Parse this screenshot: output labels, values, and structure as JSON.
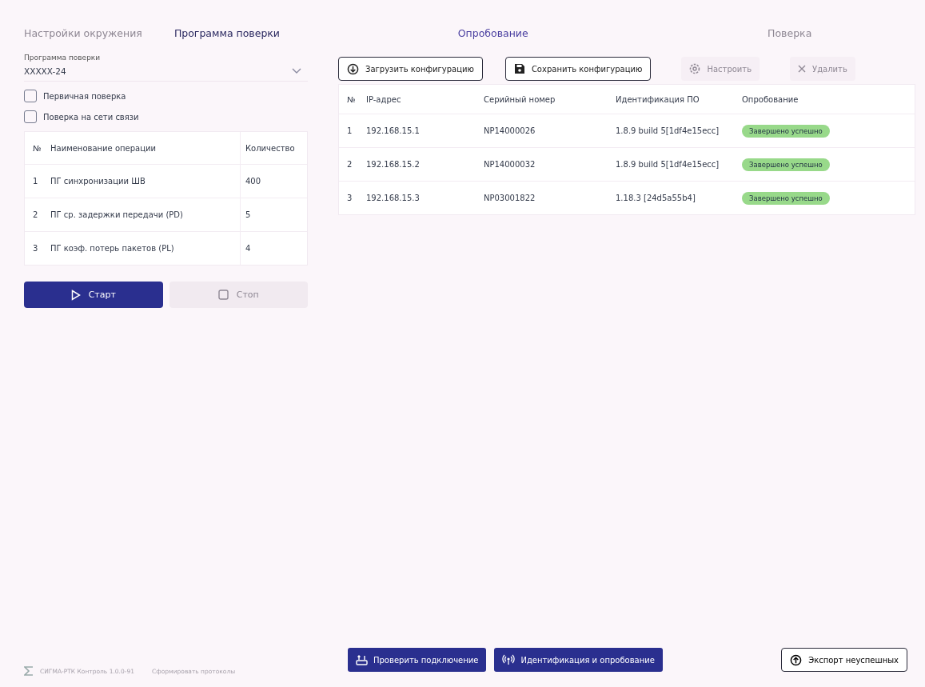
{
  "left_tabs": [
    {
      "label": "Настройки окружения",
      "disabled": true
    },
    {
      "label": "Программа поверки",
      "disabled": false
    }
  ],
  "right_tabs": [
    {
      "label": "Опробование",
      "disabled": false
    },
    {
      "label": "Поверка",
      "disabled": true
    }
  ],
  "program": {
    "label": "Программа поверки",
    "value": "XXXXX-24"
  },
  "checkboxes": [
    {
      "label": "Первичная поверка",
      "checked": false
    },
    {
      "label": "Поверка на сети связи",
      "checked": false
    }
  ],
  "operations": {
    "columns": [
      "№",
      "Наименование операции",
      "Количество"
    ],
    "rows": [
      [
        "1",
        "ПГ синхронизации ШВ",
        "400"
      ],
      [
        "2",
        "ПГ ср. задержки передачи (PD)",
        "5"
      ],
      [
        "3",
        "ПГ коэф. потерь пакетов (PL)",
        "4"
      ]
    ]
  },
  "run_buttons": [
    {
      "kind": "start",
      "label": "Старт",
      "disabled": false
    },
    {
      "kind": "stop",
      "label": "Стоп",
      "disabled": true
    }
  ],
  "toolbar": [
    {
      "kind": "load",
      "label": "Загрузить конфигурацию",
      "disabled": false
    },
    {
      "kind": "save",
      "label": "Сохранить конфигурацию",
      "disabled": false
    },
    {
      "kind": "configure",
      "label": "Настроить",
      "disabled": true
    },
    {
      "kind": "delete",
      "label": "Удалить",
      "disabled": true
    }
  ],
  "devices": {
    "columns": [
      "№",
      "IP-адрес",
      "Серийный номер",
      "Идентификация ПО",
      "Опробование"
    ],
    "rows": [
      {
        "cells": [
          "1",
          "192.168.15.1",
          "NP14000026",
          "1.8.9 build 5[1df4e15ecc]"
        ],
        "status": "Завершено успешно",
        "kind": "success"
      },
      {
        "cells": [
          "2",
          "192.168.15.2",
          "NP14000032",
          "1.8.9 build 5[1df4e15ecc]"
        ],
        "status": "Завершено успешно",
        "kind": "success"
      },
      {
        "cells": [
          "3",
          "192.168.15.3",
          "NP03001822",
          "1.18.3 [24d5a55b4]"
        ],
        "status": "Завершено успешно",
        "kind": "success"
      }
    ]
  },
  "footer": {
    "app": "СИГМА-РТК Контроль 1.0.0-91",
    "link": "Сформировать протоколы"
  },
  "actions": [
    {
      "kind": "check",
      "label": "Проверить подключение"
    },
    {
      "kind": "identify",
      "label": "Идентификация и опробование"
    }
  ],
  "export": {
    "label": "Экспорт неуспешных"
  }
}
